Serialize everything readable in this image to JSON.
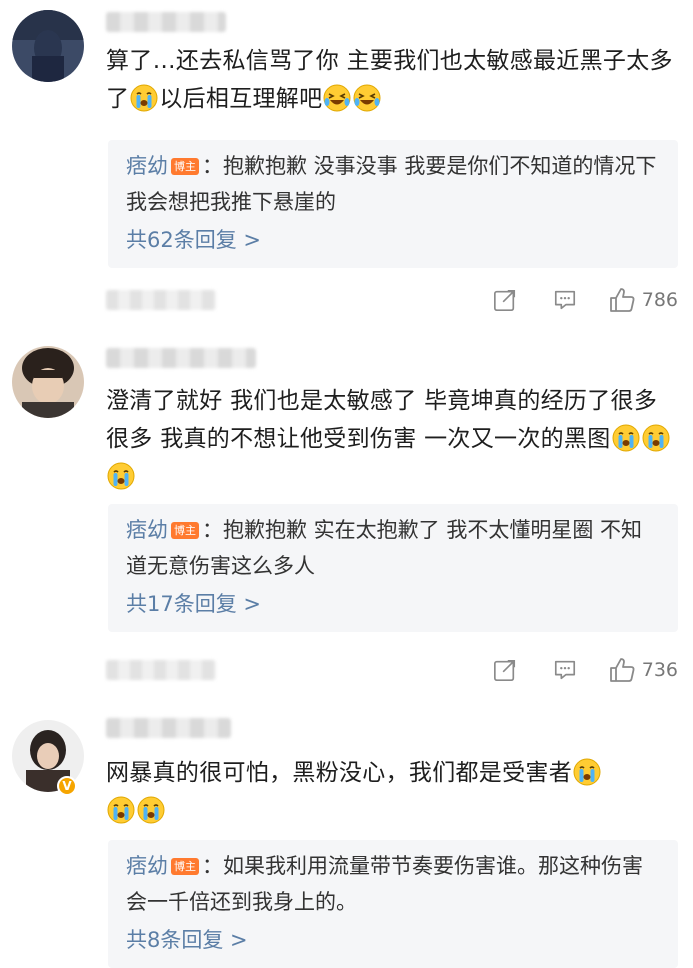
{
  "comments": [
    {
      "text_parts": [
        "算了…还去私信骂了你 主要我们也太敏感最近黑子太多了",
        "以后相互理解吧"
      ],
      "reply": {
        "author": "痞幼",
        "tag": "博主",
        "text": "：抱歉抱歉 没事没事 我要是你们不知道的情况下 我会想把我推下悬崖的",
        "more": "共62条回复 >"
      },
      "likes": "786"
    },
    {
      "text": "澄清了就好 我们也是太敏感了 毕竟坤真的经历了很多很多 我真的不想让他受到伤害 一次又一次的黑图",
      "reply": {
        "author": "痞幼",
        "tag": "博主",
        "text": "：抱歉抱歉 实在太抱歉了 我不太懂明星圈 不知道无意伤害这么多人",
        "more": "共17条回复 >"
      },
      "likes": "736"
    },
    {
      "text": "网暴真的很可怕，黑粉没心，我们都是受害者",
      "reply": {
        "author": "痞幼",
        "tag": "博主",
        "text": "：如果我利用流量带节奏要伤害谁。那这种伤害会一千倍还到我身上的。",
        "more": "共8条回复 >"
      },
      "verified_badge": "V"
    }
  ],
  "icons": {
    "share": "share-icon",
    "comment": "comment-icon",
    "like": "thumbs-up-icon",
    "emoji": "crying-emoji-icon",
    "laugh": "laughing-crying-emoji-icon"
  },
  "colors": {
    "reply_author": "#5b7ea6",
    "tag_bg": "#ff7a2f",
    "reply_bg": "#f5f6f8"
  }
}
